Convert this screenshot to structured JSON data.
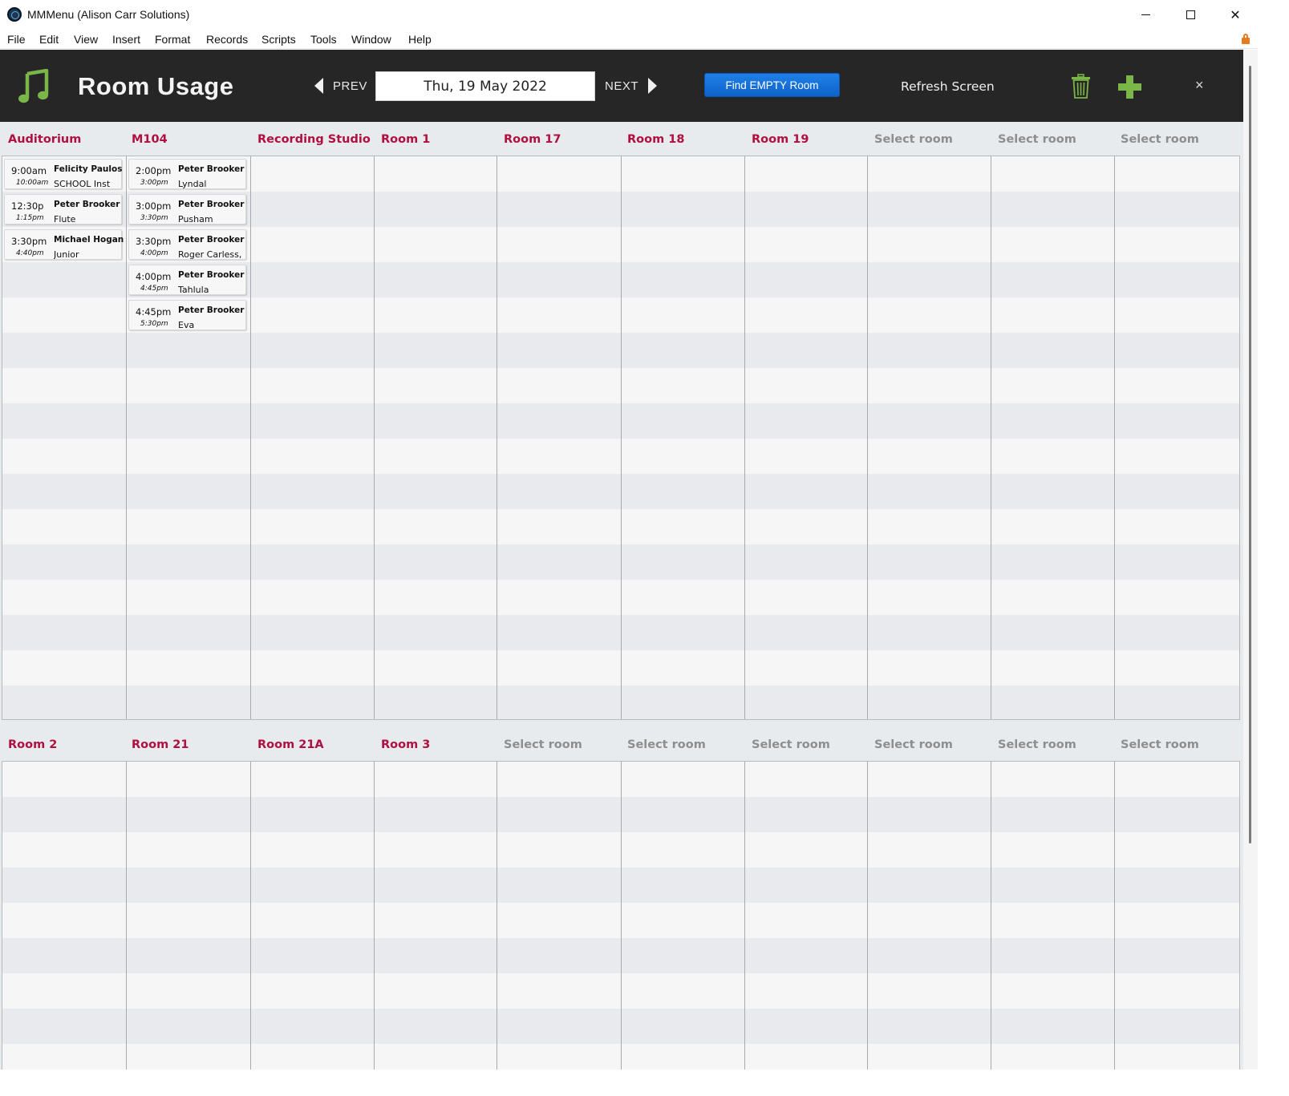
{
  "window": {
    "title": "MMMenu (Alison Carr Solutions)",
    "controls": {
      "minimize": "minimize",
      "maximize": "maximize",
      "close": "✕"
    }
  },
  "menu": [
    "File",
    "Edit",
    "View",
    "Insert",
    "Format",
    "Records",
    "Scripts",
    "Tools",
    "Window",
    "Help"
  ],
  "header": {
    "title": "Room Usage",
    "prev_label": "PREV",
    "next_label": "NEXT",
    "date": "Thu, 19 May 2022",
    "find_label": "Find EMPTY Room",
    "refresh_label": "Refresh Screen",
    "close_label": "×"
  },
  "colors": {
    "header_bg": "#262626",
    "room_name": "#b0103f",
    "empty_room": "#8e8e8e",
    "find_button": "#1670d8",
    "icon_green": "#7ab648"
  },
  "icons": [
    "music-note-icon",
    "trash-icon",
    "plus-icon",
    "lock-icon"
  ],
  "section1": {
    "rooms": [
      "Auditorium",
      "M104",
      "Recording Studio",
      "Room 1",
      "Room 17",
      "Room 18",
      "Room 19",
      "Select room",
      "Select room",
      "Select room"
    ],
    "bookings": [
      [
        {
          "start": "9:00am",
          "end": "10:00am",
          "teacher": "Felicity Paulos",
          "student": "SCHOOL Inst"
        },
        {
          "start": "12:30p",
          "end": "1:15pm",
          "teacher": "Peter Brooker",
          "student": "Flute"
        },
        {
          "start": "3:30pm",
          "end": "4:40pm",
          "teacher": "Michael Hogan",
          "student": "Junior"
        }
      ],
      [
        {
          "start": "2:00pm",
          "end": "3:00pm",
          "teacher": "Peter Brooker",
          "student": "Lyndal"
        },
        {
          "start": "3:00pm",
          "end": "3:30pm",
          "teacher": "Peter Brooker",
          "student": "Pusham"
        },
        {
          "start": "3:30pm",
          "end": "4:00pm",
          "teacher": "Peter Brooker",
          "student": "Roger Carless,"
        },
        {
          "start": "4:00pm",
          "end": "4:45pm",
          "teacher": "Peter Brooker",
          "student": "Tahlula"
        },
        {
          "start": "4:45pm",
          "end": "5:30pm",
          "teacher": "Peter Brooker",
          "student": "Eva"
        }
      ]
    ]
  },
  "section2": {
    "rooms": [
      "Room 2",
      "Room 21",
      "Room 21A",
      "Room 3",
      "Select room",
      "Select room",
      "Select room",
      "Select room",
      "Select room",
      "Select room"
    ]
  }
}
